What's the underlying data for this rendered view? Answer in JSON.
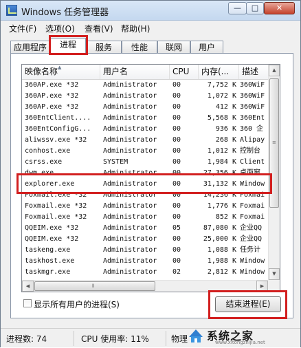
{
  "window": {
    "title": "Windows 任务管理器",
    "controls": {
      "minimize": "—",
      "maximize": "□",
      "close": "✕"
    }
  },
  "menu": [
    {
      "label": "文件(F)"
    },
    {
      "label": "选项(O)"
    },
    {
      "label": "查看(V)"
    },
    {
      "label": "帮助(H)"
    }
  ],
  "tabs": [
    {
      "label": "应用程序",
      "active": false
    },
    {
      "label": "进程",
      "active": true
    },
    {
      "label": "服务",
      "active": false
    },
    {
      "label": "性能",
      "active": false
    },
    {
      "label": "联网",
      "active": false
    },
    {
      "label": "用户",
      "active": false
    }
  ],
  "process_table": {
    "columns": [
      "映像名称",
      "用户名",
      "CPU",
      "内存(...",
      "描述"
    ],
    "rows": [
      {
        "name": "360AP.exe *32",
        "user": "Administrator",
        "cpu": "00",
        "memory": "7,752 K",
        "desc": "360WiF"
      },
      {
        "name": "360AP.exe *32",
        "user": "Administrator",
        "cpu": "00",
        "memory": "1,072 K",
        "desc": "360WiF"
      },
      {
        "name": "360AP.exe *32",
        "user": "Administrator",
        "cpu": "00",
        "memory": "412 K",
        "desc": "360WiF"
      },
      {
        "name": "360EntClient....",
        "user": "Administrator",
        "cpu": "00",
        "memory": "5,568 K",
        "desc": "360Ent"
      },
      {
        "name": "360EntConfigG...",
        "user": "Administrator",
        "cpu": "00",
        "memory": "936 K",
        "desc": "360 企"
      },
      {
        "name": "aliwssv.exe *32",
        "user": "Administrator",
        "cpu": "00",
        "memory": "268 K",
        "desc": "Alipay"
      },
      {
        "name": "conhost.exe",
        "user": "Administrator",
        "cpu": "00",
        "memory": "1,012 K",
        "desc": "控制台"
      },
      {
        "name": "csrss.exe",
        "user": "SYSTEM",
        "cpu": "00",
        "memory": "1,984 K",
        "desc": "Client"
      },
      {
        "name": "dwm.exe",
        "user": "Administrator",
        "cpu": "00",
        "memory": "27,356 K",
        "desc": "桌面窗"
      },
      {
        "name": "explorer.exe",
        "user": "Administrator",
        "cpu": "00",
        "memory": "31,132 K",
        "desc": "Window"
      },
      {
        "name": "Foxmail.exe *32",
        "user": "Administrator",
        "cpu": "00",
        "memory": "14,236 K",
        "desc": "Foxmai"
      },
      {
        "name": "Foxmail.exe *32",
        "user": "Administrator",
        "cpu": "00",
        "memory": "1,776 K",
        "desc": "Foxmai"
      },
      {
        "name": "Foxmail.exe *32",
        "user": "Administrator",
        "cpu": "00",
        "memory": "852 K",
        "desc": "Foxmai"
      },
      {
        "name": "QQEIM.exe *32",
        "user": "Administrator",
        "cpu": "05",
        "memory": "87,080 K",
        "desc": "企业QQ"
      },
      {
        "name": "QQEIM.exe *32",
        "user": "Administrator",
        "cpu": "00",
        "memory": "25,000 K",
        "desc": "企业QQ"
      },
      {
        "name": "taskeng.exe",
        "user": "Administrator",
        "cpu": "00",
        "memory": "1,088 K",
        "desc": "任务计"
      },
      {
        "name": "taskhost.exe",
        "user": "Administrator",
        "cpu": "00",
        "memory": "1,988 K",
        "desc": "Window"
      },
      {
        "name": "taskmgr.exe",
        "user": "Administrator",
        "cpu": "02",
        "memory": "2,812 K",
        "desc": "Window"
      }
    ],
    "highlighted_process": "explorer.exe"
  },
  "show_all_users": {
    "label": "显示所有用户的进程(S)",
    "checked": false
  },
  "end_process_button": "结束进程(E)",
  "status": {
    "process_count": "进程数: 74",
    "cpu_usage": "CPU 使用率: 11%",
    "memory": "物理"
  },
  "watermark": {
    "text": "系统之家",
    "url": "www.xitongzhijia.net"
  },
  "colors": {
    "annotation_red": "#d21f1f",
    "titlebar": "#c4d8ef",
    "close_button": "#c4422c"
  }
}
